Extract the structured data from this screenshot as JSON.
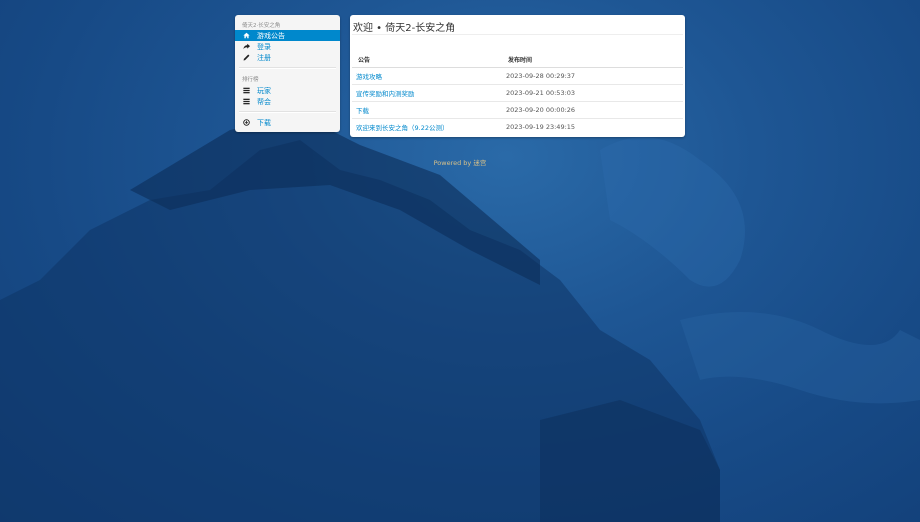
{
  "colors": {
    "accent": "#0088cc",
    "background": "#1a4f8c",
    "footer": "#d6c08a"
  },
  "sidebar": {
    "header_game": "倚天2·长安之角",
    "header_rank": "排行榜",
    "items": [
      {
        "label": "游戏公告",
        "icon": "home-icon",
        "active": true
      },
      {
        "label": "登录",
        "icon": "share-arrow-icon",
        "active": false
      },
      {
        "label": "注册",
        "icon": "pencil-icon",
        "active": false
      },
      {
        "label": "玩家",
        "icon": "list-icon",
        "active": false
      },
      {
        "label": "帮会",
        "icon": "list-icon",
        "active": false
      },
      {
        "label": "下载",
        "icon": "download-circle-icon",
        "active": false
      }
    ]
  },
  "main": {
    "title": "欢迎 • 倚天2-长安之角",
    "table": {
      "headers": [
        "公告",
        "发布时间"
      ],
      "rows": [
        {
          "title": "游戏攻略",
          "time": "2023-09-28 00:29:37"
        },
        {
          "title": "宣传奖励和内测奖励",
          "time": "2023-09-21 00:53:03"
        },
        {
          "title": "下载",
          "time": "2023-09-20 00:00:26"
        },
        {
          "title": "欢迎来到长安之角（9.22公测）",
          "time": "2023-09-19 23:49:15"
        }
      ]
    }
  },
  "footer": {
    "prefix": "Powered by",
    "name": "迷宫"
  }
}
